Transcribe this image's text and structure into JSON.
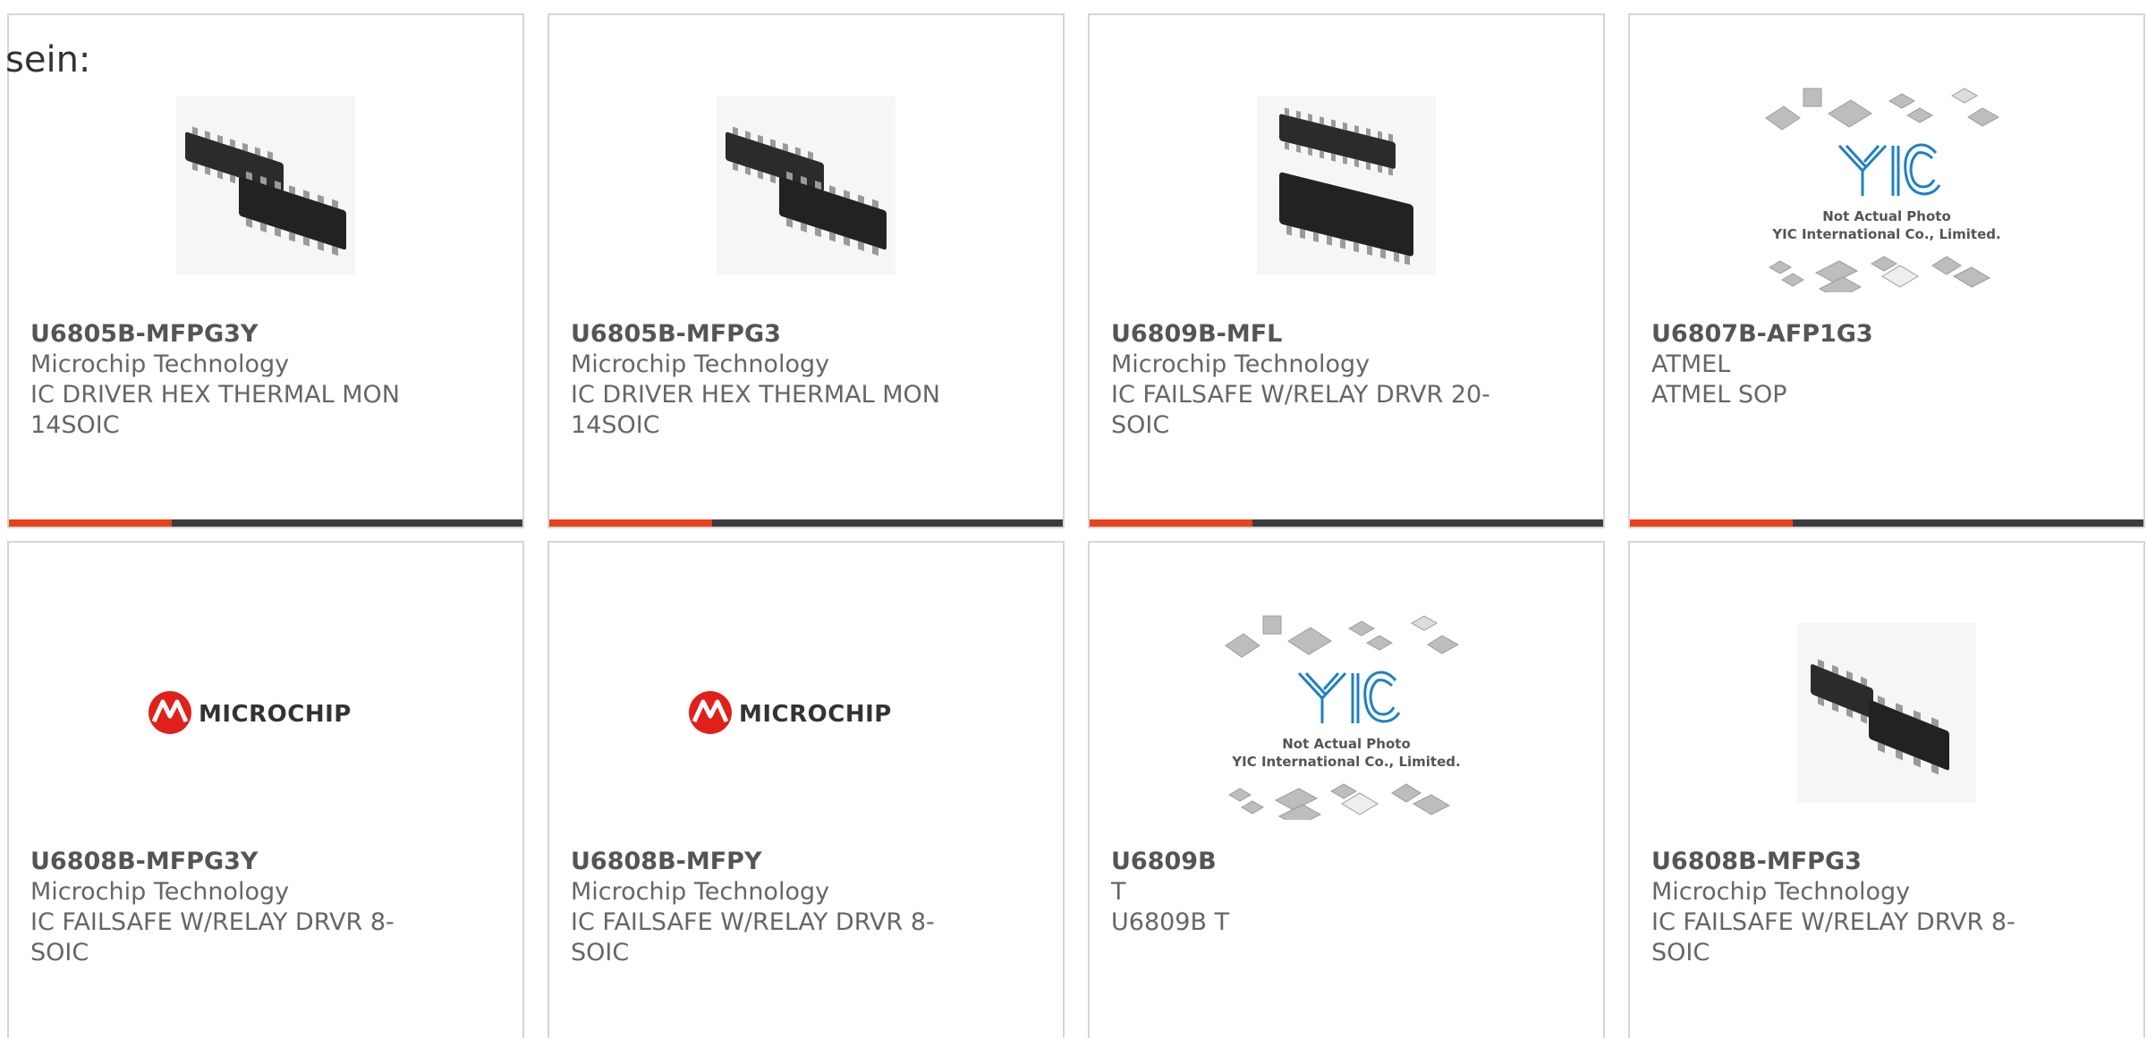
{
  "intro_text": "sein:",
  "colors": {
    "accent": "#e8411c",
    "bar": "#3c3c3c",
    "border": "#d6d6d6",
    "text": "#666666",
    "microchip_red": "#e0201b",
    "yic_blue": "#1f7fc4"
  },
  "placeholder": {
    "note_line1": "Not Actual Photo",
    "note_line2": "YIC International Co., Limited.",
    "logo_text": "YIC"
  },
  "microchip_logo_text": "MICROCHIP",
  "products": [
    {
      "part": "U6805B-MFPG3Y",
      "maker": "Microchip Technology",
      "desc": "IC DRIVER HEX THERMAL MON 14SOIC",
      "image": "soic-14-icon"
    },
    {
      "part": "U6805B-MFPG3",
      "maker": "Microchip Technology",
      "desc": "IC DRIVER HEX THERMAL MON 14SOIC",
      "image": "soic-14-icon"
    },
    {
      "part": "U6809B-MFL",
      "maker": "Microchip Technology",
      "desc": "IC FAILSAFE W/RELAY DRVR 20-SOIC",
      "image": "soic-20-icon"
    },
    {
      "part": "U6807B-AFP1G3",
      "maker": "ATMEL",
      "desc": "ATMEL SOP",
      "image": "yic-placeholder-icon"
    },
    {
      "part": "U6808B-MFPG3Y",
      "maker": "Microchip Technology",
      "desc": "IC FAILSAFE W/RELAY DRVR 8-SOIC",
      "image": "microchip-logo"
    },
    {
      "part": "U6808B-MFPY",
      "maker": "Microchip Technology",
      "desc": "IC FAILSAFE W/RELAY DRVR 8-SOIC",
      "image": "microchip-logo"
    },
    {
      "part": "U6809B",
      "maker": "T",
      "desc": "U6809B T",
      "image": "yic-placeholder-icon"
    },
    {
      "part": "U6808B-MFPG3",
      "maker": "Microchip Technology",
      "desc": "IC FAILSAFE W/RELAY DRVR 8-SOIC",
      "image": "soic-8-icon"
    }
  ]
}
